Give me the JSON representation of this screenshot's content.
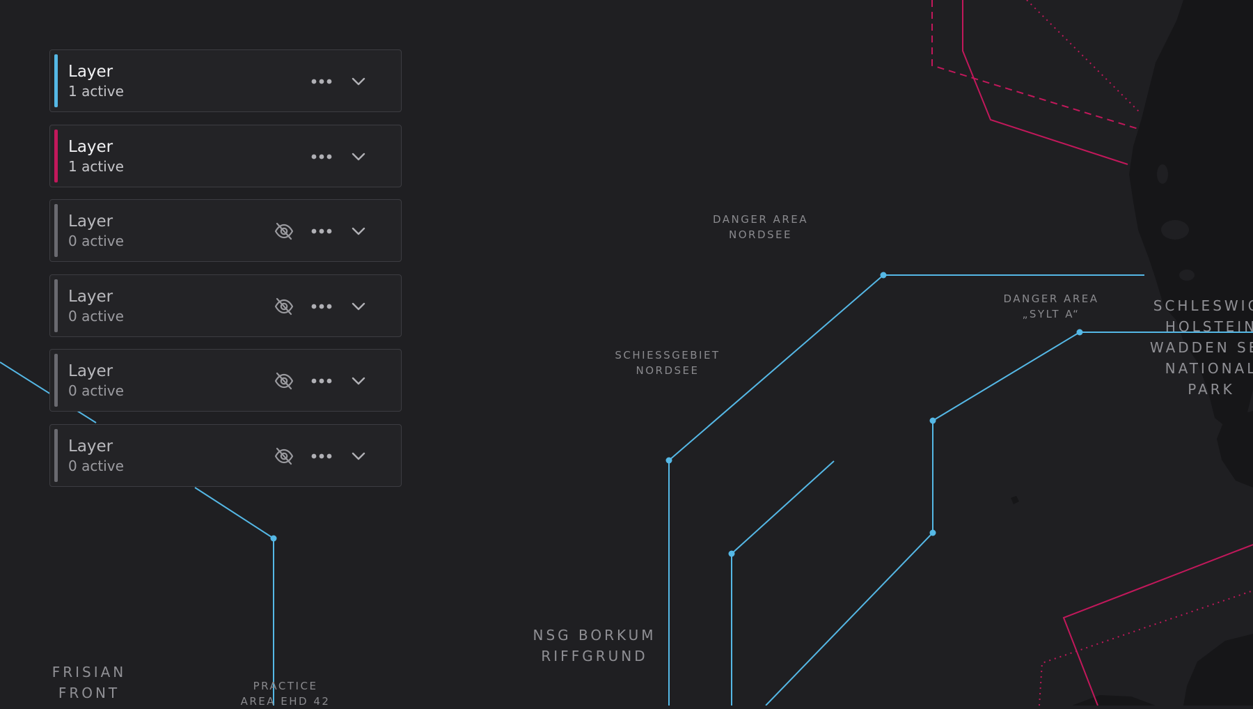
{
  "colors": {
    "background": "#1f1f22",
    "blue_boundary": "#55b8e6",
    "magenta_boundary": "#c2185b",
    "inactive_bar": "#6a6a70",
    "card_background": "#232326",
    "card_border": "#3d3d42"
  },
  "layers": [
    {
      "name": "Layer",
      "count": "1 active",
      "color": "#55b8e6",
      "visible": true
    },
    {
      "name": "Layer",
      "count": "1 active",
      "color": "#c2185b",
      "visible": true
    },
    {
      "name": "Layer",
      "count": "0 active",
      "color": "#6a6a70",
      "visible": false
    },
    {
      "name": "Layer",
      "count": "0 active",
      "color": "#6a6a70",
      "visible": false
    },
    {
      "name": "Layer",
      "count": "0 active",
      "color": "#6a6a70",
      "visible": false
    },
    {
      "name": "Layer",
      "count": "0 active",
      "color": "#6a6a70",
      "visible": false
    }
  ],
  "icons": {
    "hidden": "eye-off-icon",
    "more": "more-horizontal-icon",
    "expand": "chevron-down-icon"
  },
  "map_labels": [
    {
      "id": "danger-area-nordsee",
      "text": "DANGER AREA\nNORDSEE"
    },
    {
      "id": "danger-area-sylt-a",
      "text": "DANGER AREA\n„SYLT A“"
    },
    {
      "id": "schiessgebiet-nordsee",
      "text": "SCHIESSGEBIET\nNORDSEE"
    },
    {
      "id": "schleswig-holstein",
      "text": "SCHLESWIG-\nHOLSTEIN\nWADDEN SEA\nNATIONAL\nPARK"
    },
    {
      "id": "nsg-borkum",
      "text": "NSG BORKUM\nRIFFGRUND"
    },
    {
      "id": "frisian-front",
      "text": "FRISIAN\nFRONT"
    },
    {
      "id": "practice-area",
      "text": "PRACTICE\nAREA EHD 42"
    }
  ]
}
